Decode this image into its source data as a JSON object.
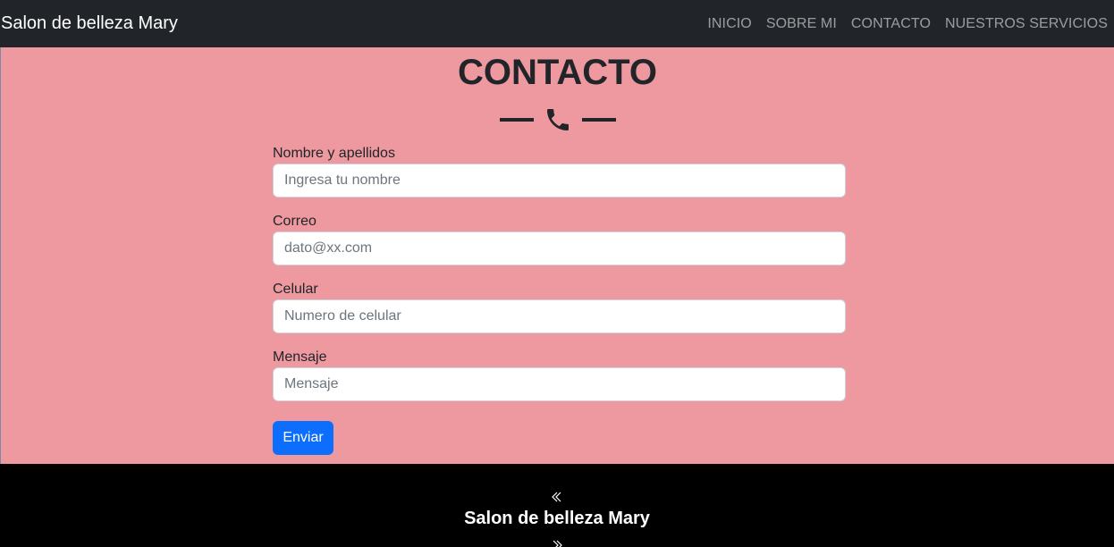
{
  "navbar": {
    "brand": "Salon de belleza Mary",
    "links": [
      {
        "label": "INICIO"
      },
      {
        "label": "SOBRE MI"
      },
      {
        "label": "CONTACTO"
      },
      {
        "label": "NUESTROS SERVICIOS"
      }
    ]
  },
  "contact": {
    "title": "CONTACTO",
    "divider_icon": "phone-icon",
    "fields": [
      {
        "label": "Nombre y apellidos",
        "placeholder": "Ingresa tu nombre",
        "value": ""
      },
      {
        "label": "Correo",
        "placeholder": "dato@xx.com",
        "value": ""
      },
      {
        "label": "Celular",
        "placeholder": "Numero de celular",
        "value": ""
      },
      {
        "label": "Mensaje",
        "placeholder": "Mensaje",
        "value": ""
      }
    ],
    "submit_label": "Enviar"
  },
  "footer": {
    "title": "Salon de belleza Mary",
    "top_icon": "double-chevron-left-icon",
    "bottom_icon": "double-chevron-right-icon"
  },
  "colors": {
    "navbar_bg": "#212529",
    "section_bg": "#ed999f",
    "button_bg": "#0d6efd",
    "footer_bg": "#000000"
  }
}
